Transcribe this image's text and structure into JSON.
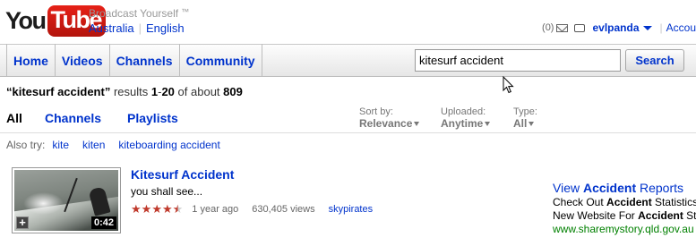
{
  "logo": {
    "you": "You",
    "tube": "Tube"
  },
  "header": {
    "slogan": "Broadcast Yourself",
    "trademark": "™",
    "country": "Australia",
    "language": "English"
  },
  "account": {
    "message_count": "(0)",
    "mail_icon": "envelope-icon",
    "tv_icon": "tv-icon",
    "username": "evlpanda",
    "account_link": "Accou"
  },
  "nav": {
    "tabs": [
      {
        "label": "Home"
      },
      {
        "label": "Videos"
      },
      {
        "label": "Channels"
      },
      {
        "label": "Community"
      }
    ]
  },
  "search": {
    "query": "kitesurf accident",
    "button_label": "Search"
  },
  "results": {
    "query_quoted": "“kitesurf accident”",
    "results_word": "results",
    "range_start": "1",
    "dash": "-",
    "range_end": "20",
    "of_about": "of about",
    "total": "809"
  },
  "filters": {
    "tabs": [
      {
        "label": "All",
        "active": true
      },
      {
        "label": "Channels",
        "active": false
      },
      {
        "label": "Playlists",
        "active": false
      }
    ],
    "sort_by": {
      "label": "Sort by:",
      "value": "Relevance"
    },
    "uploaded": {
      "label": "Uploaded:",
      "value": "Anytime"
    },
    "type": {
      "label": "Type:",
      "value": "All"
    }
  },
  "also_try": {
    "label": "Also try:",
    "suggestions": [
      "kite",
      "kiten",
      "kiteboarding accident"
    ]
  },
  "video": {
    "title": "Kitesurf Accident",
    "description": "you shall see...",
    "rating": 4.5,
    "rating_max": 5,
    "age": "1 year ago",
    "views": "630,405 views",
    "channel": "skypirates",
    "duration": "0:42",
    "add_icon": "plus-icon"
  },
  "ad": {
    "title_pre": "View ",
    "title_bold": "Accident",
    "title_post": " Reports",
    "line1_pre": "Check Out ",
    "line1_bold": "Accident",
    "line1_post": " Statistics",
    "line2_pre": "New Website For ",
    "line2_bold": "Accident",
    "line2_post": " St",
    "url": "www.sharemystory.qld.gov.au"
  },
  "colors": {
    "link": "#0033cc",
    "star": "#c0392b",
    "ad_url": "#008000",
    "logo_red": "#e62117"
  }
}
